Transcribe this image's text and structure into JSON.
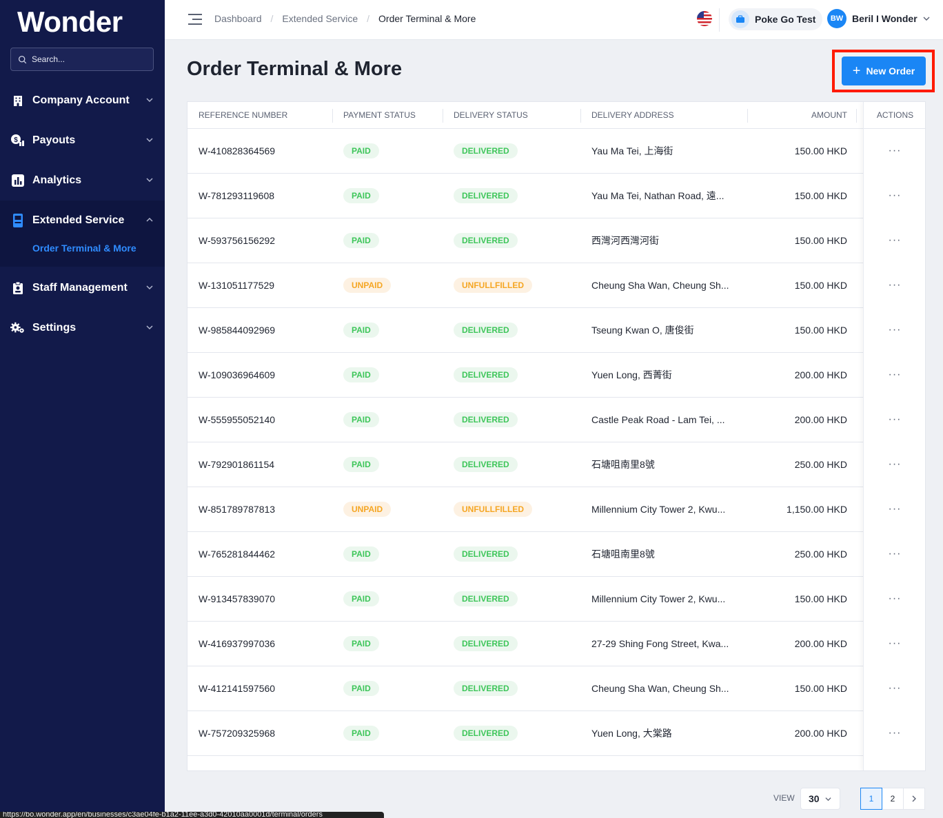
{
  "brand": "Wonder",
  "search": {
    "placeholder": "Search..."
  },
  "sidebar": {
    "items": [
      {
        "label": "Company Account",
        "icon": "building-icon"
      },
      {
        "label": "Payouts",
        "icon": "payouts-icon"
      },
      {
        "label": "Analytics",
        "icon": "analytics-icon"
      },
      {
        "label": "Extended Service",
        "icon": "terminal-icon",
        "expanded": true
      },
      {
        "label": "Staff Management",
        "icon": "staff-icon"
      },
      {
        "label": "Settings",
        "icon": "gears-icon"
      }
    ],
    "sub_item": "Order Terminal & More"
  },
  "topbar": {
    "breadcrumbs": [
      "Dashboard",
      "Extended Service",
      "Order Terminal & More"
    ],
    "store_name": "Poke Go Test",
    "user_initials": "BW",
    "user_name": "Beril I Wonder"
  },
  "page": {
    "title": "Order Terminal & More",
    "new_order_label": "New Order"
  },
  "table": {
    "headers": {
      "ref": "REFERENCE NUMBER",
      "payment": "PAYMENT STATUS",
      "delivery": "DELIVERY STATUS",
      "address": "DELIVERY ADDRESS",
      "amount": "AMOUNT",
      "actions": "ACTIONS"
    },
    "rows": [
      {
        "ref": "W-410828364569",
        "payment": "PAID",
        "delivery": "DELIVERED",
        "address": "Yau Ma Tei, 上海街",
        "amount": "150.00 HKD"
      },
      {
        "ref": "W-781293119608",
        "payment": "PAID",
        "delivery": "DELIVERED",
        "address": "Yau Ma Tei, Nathan Road, 遠...",
        "amount": "150.00 HKD"
      },
      {
        "ref": "W-593756156292",
        "payment": "PAID",
        "delivery": "DELIVERED",
        "address": "西灣河西灣河街",
        "amount": "150.00 HKD"
      },
      {
        "ref": "W-131051177529",
        "payment": "UNPAID",
        "delivery": "UNFULLFILLED",
        "address": "Cheung Sha Wan, Cheung Sh...",
        "amount": "150.00 HKD"
      },
      {
        "ref": "W-985844092969",
        "payment": "PAID",
        "delivery": "DELIVERED",
        "address": "Tseung Kwan O, 唐俊街",
        "amount": "150.00 HKD"
      },
      {
        "ref": "W-109036964609",
        "payment": "PAID",
        "delivery": "DELIVERED",
        "address": "Yuen Long, 西菁街",
        "amount": "200.00 HKD"
      },
      {
        "ref": "W-555955052140",
        "payment": "PAID",
        "delivery": "DELIVERED",
        "address": "Castle Peak Road - Lam Tei, ...",
        "amount": "200.00 HKD"
      },
      {
        "ref": "W-792901861154",
        "payment": "PAID",
        "delivery": "DELIVERED",
        "address": "石塘咀南里8號",
        "amount": "250.00 HKD"
      },
      {
        "ref": "W-851789787813",
        "payment": "UNPAID",
        "delivery": "UNFULLFILLED",
        "address": "Millennium City Tower 2, Kwu...",
        "amount": "1,150.00 HKD"
      },
      {
        "ref": "W-765281844462",
        "payment": "PAID",
        "delivery": "DELIVERED",
        "address": "石塘咀南里8號",
        "amount": "250.00 HKD"
      },
      {
        "ref": "W-913457839070",
        "payment": "PAID",
        "delivery": "DELIVERED",
        "address": "Millennium City Tower 2, Kwu...",
        "amount": "150.00 HKD"
      },
      {
        "ref": "W-416937997036",
        "payment": "PAID",
        "delivery": "DELIVERED",
        "address": "27-29 Shing Fong Street, Kwa...",
        "amount": "200.00 HKD"
      },
      {
        "ref": "W-412141597560",
        "payment": "PAID",
        "delivery": "DELIVERED",
        "address": "Cheung Sha Wan, Cheung Sh...",
        "amount": "150.00 HKD"
      },
      {
        "ref": "W-757209325968",
        "payment": "PAID",
        "delivery": "DELIVERED",
        "address": "Yuen Long, 大棠路",
        "amount": "200.00 HKD"
      }
    ],
    "actions_glyph": "···"
  },
  "pagination": {
    "view_label": "VIEW",
    "per_page": "30",
    "pages": [
      "1",
      "2"
    ],
    "current_page": "1"
  },
  "status_url": "https://bo.wonder.app/en/businesses/c3ae04fe-b1a2-11ee-a3d0-42010aa0001d/terminal/orders",
  "colors": {
    "sidebar_bg": "#121a4a",
    "accent": "#1a86f5",
    "paid": "#3ec65a",
    "unpaid": "#f5a623",
    "highlight": "#ff1a00"
  }
}
